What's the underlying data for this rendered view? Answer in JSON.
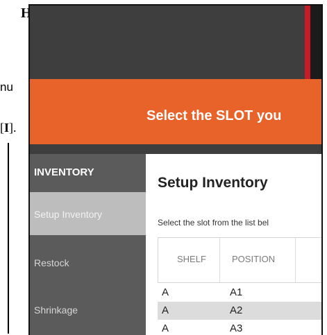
{
  "margin": {
    "heading_letter": "H",
    "fragment_mu": "nu",
    "fragment_ref_open": "[",
    "fragment_ref_letter": "I",
    "fragment_ref_close": "]."
  },
  "banner": {
    "text": "Select the SLOT you"
  },
  "sidebar": {
    "header": "INVENTORY",
    "items": [
      {
        "label": "Setup Inventory",
        "active": true
      },
      {
        "label": "Restock",
        "active": false
      },
      {
        "label": "Shrinkage",
        "active": false
      }
    ]
  },
  "main": {
    "title": "Setup Inventory",
    "subtitle": "Select the slot from the list bel",
    "table": {
      "columns": [
        "SHELF",
        "POSITION"
      ],
      "rows": [
        {
          "shelf": "A",
          "position": "A1"
        },
        {
          "shelf": "A",
          "position": "A2"
        },
        {
          "shelf": "A",
          "position": "A3"
        }
      ]
    }
  },
  "colors": {
    "banner": "#e8632a",
    "sidebar": "#5b5b5b",
    "sidebar_active": "#bdbdbd",
    "titlebar": "#3e3e3e",
    "accent": "#c91a28"
  }
}
